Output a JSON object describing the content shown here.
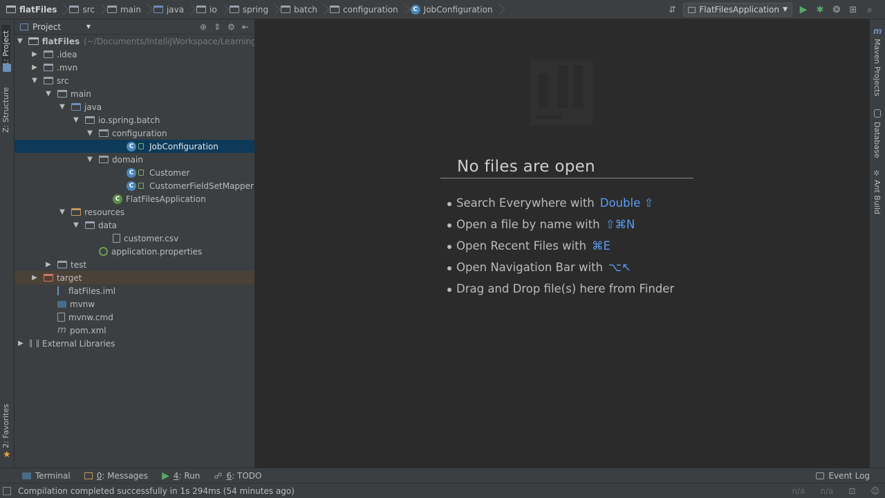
{
  "navbar": {
    "crumbs": [
      "flatFiles",
      "src",
      "main",
      "java",
      "io",
      "spring",
      "batch",
      "configuration",
      "JobConfiguration"
    ],
    "run_config": "FlatFilesApplication"
  },
  "left_stripe": {
    "project_tab": "1: Project",
    "structure_tab": "Z: Structure",
    "favorites_tab": "2: Favorites"
  },
  "project_panel": {
    "dropdown_label": "Project",
    "tree": [
      {
        "label": "flatFiles",
        "hint": "(~/Documents/IntelliJWorkspace/LearningSp",
        "depth": 0,
        "arrow": "open",
        "icon": "project-folder-icon"
      },
      {
        "label": ".idea",
        "depth": 1,
        "arrow": "closed",
        "icon": "folder-icon"
      },
      {
        "label": ".mvn",
        "depth": 1,
        "arrow": "closed",
        "icon": "folder-icon"
      },
      {
        "label": "src",
        "depth": 1,
        "arrow": "open",
        "icon": "folder-icon"
      },
      {
        "label": "main",
        "depth": 2,
        "arrow": "open",
        "icon": "folder-icon"
      },
      {
        "label": "java",
        "depth": 3,
        "arrow": "open",
        "icon": "source-folder-icon"
      },
      {
        "label": "io.spring.batch",
        "depth": 4,
        "arrow": "open",
        "icon": "package-icon"
      },
      {
        "label": "configuration",
        "depth": 5,
        "arrow": "open",
        "icon": "package-icon"
      },
      {
        "label": "JobConfiguration",
        "depth": 7,
        "arrow": "none",
        "icon": "class-icon",
        "selected": true
      },
      {
        "label": "domain",
        "depth": 5,
        "arrow": "open",
        "icon": "package-icon"
      },
      {
        "label": "Customer",
        "depth": 7,
        "arrow": "none",
        "icon": "class-icon"
      },
      {
        "label": "CustomerFieldSetMapper",
        "depth": 7,
        "arrow": "none",
        "icon": "class-icon"
      },
      {
        "label": "FlatFilesApplication",
        "depth": 6,
        "arrow": "none",
        "icon": "spring-class-icon"
      },
      {
        "label": "resources",
        "depth": 3,
        "arrow": "open",
        "icon": "resources-folder-icon"
      },
      {
        "label": "data",
        "depth": 4,
        "arrow": "open",
        "icon": "folder-icon"
      },
      {
        "label": "customer.csv",
        "depth": 6,
        "arrow": "none",
        "icon": "text-file-icon"
      },
      {
        "label": "application.properties",
        "depth": 5,
        "arrow": "none",
        "icon": "spring-properties-icon"
      },
      {
        "label": "test",
        "depth": 2,
        "arrow": "closed",
        "icon": "folder-icon"
      },
      {
        "label": "target",
        "depth": 1,
        "arrow": "closed",
        "icon": "excluded-folder-icon",
        "excluded": true
      },
      {
        "label": "flatFiles.iml",
        "depth": 2,
        "arrow": "none",
        "icon": "iml-file-icon"
      },
      {
        "label": "mvnw",
        "depth": 2,
        "arrow": "none",
        "icon": "shell-script-icon"
      },
      {
        "label": "mvnw.cmd",
        "depth": 2,
        "arrow": "none",
        "icon": "text-file-icon"
      },
      {
        "label": "pom.xml",
        "depth": 2,
        "arrow": "none",
        "icon": "maven-file-icon"
      },
      {
        "label": "External Libraries",
        "depth": 0,
        "arrow": "closed",
        "icon": "library-icon"
      }
    ]
  },
  "editor": {
    "empty_title": "No files are open",
    "hints": [
      {
        "text": "Search Everywhere with",
        "shortcut": "Double ⇧"
      },
      {
        "text": "Open a file by name with",
        "shortcut": "⇧⌘N"
      },
      {
        "text": "Open Recent Files with",
        "shortcut": "⌘E"
      },
      {
        "text": "Open Navigation Bar with",
        "shortcut": "⌥↖"
      },
      {
        "text": "Drag and Drop file(s) here from Finder",
        "shortcut": ""
      }
    ]
  },
  "right_stripe": {
    "maven": "Maven Projects",
    "database": "Database",
    "ant": "Ant Build"
  },
  "bottom_bar": {
    "terminal": "Terminal",
    "messages_num": "0",
    "messages": ": Messages",
    "run_num": "4",
    "run": ": Run",
    "todo_num": "6",
    "todo": ": TODO",
    "event_log": "Event Log"
  },
  "status": {
    "message": "Compilation completed successfully in 1s 294ms (54 minutes ago)",
    "pos1": "n/a",
    "pos2": "n/a"
  },
  "colors": {
    "accent_link": "#589df6",
    "selection": "#0d3a58",
    "run_green": "#59a869"
  }
}
